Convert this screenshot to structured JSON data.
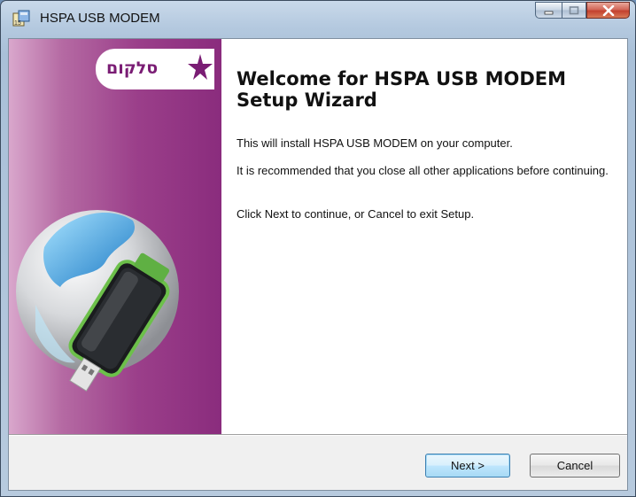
{
  "window": {
    "title": "HSPA USB MODEM"
  },
  "sidebar": {
    "logo_text": "סלקום"
  },
  "content": {
    "heading": "Welcome for HSPA USB MODEM Setup Wizard",
    "line1": "This will install HSPA USB MODEM on your computer.",
    "line2": "It is recommended that you close all other applications before continuing.",
    "line3": "Click Next to continue, or Cancel to exit Setup."
  },
  "buttons": {
    "next": "Next >",
    "cancel": "Cancel"
  },
  "colors": {
    "sidebar_purple": "#8a2c7d",
    "logo_purple": "#7a1d74"
  }
}
